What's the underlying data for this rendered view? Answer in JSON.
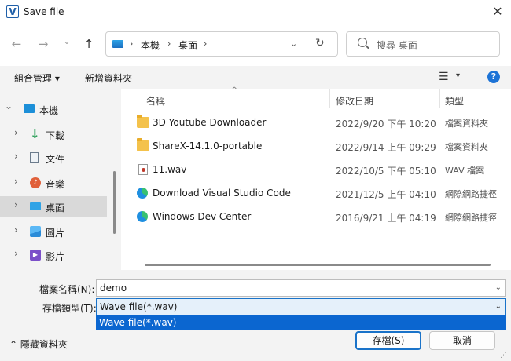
{
  "window": {
    "app_icon_letter": "V",
    "title": "Save file",
    "close_glyph": "✕"
  },
  "nav": {
    "back_glyph": "←",
    "forward_glyph": "→",
    "history_glyph": "⌄",
    "up_glyph": "↑",
    "breadcrumb": [
      "本機",
      "桌面"
    ],
    "refresh_glyph": "↻",
    "search_placeholder": "搜尋 桌面"
  },
  "toolbar": {
    "organize_label": "組合管理 ▾",
    "new_folder_label": "新增資料夾",
    "view_glyph": "☰",
    "view_chevron": "▾",
    "help_glyph": "?"
  },
  "sidebar": {
    "items": [
      {
        "label": "本機",
        "icon": "pc-icon",
        "chevron": "⌄",
        "color": "#1c8fd8"
      },
      {
        "label": "下載",
        "icon": "download-icon",
        "chevron": "›",
        "color": "#2e9f5a"
      },
      {
        "label": "文件",
        "icon": "documents-icon",
        "chevron": "›",
        "color": "#6b7b8c"
      },
      {
        "label": "音樂",
        "icon": "music-icon",
        "chevron": "›",
        "color": "#e0603a"
      },
      {
        "label": "桌面",
        "icon": "desktop-icon",
        "chevron": "›",
        "color": "#2fa3e6"
      },
      {
        "label": "圖片",
        "icon": "pictures-icon",
        "chevron": "›",
        "color": "#2a8bd8"
      },
      {
        "label": "影片",
        "icon": "videos-icon",
        "chevron": "›",
        "color": "#7b4fc9"
      }
    ]
  },
  "filelist": {
    "columns": [
      "名稱",
      "修改日期",
      "類型"
    ],
    "sort_glyph": "^",
    "rows": [
      {
        "name": "3D Youtube Downloader",
        "date": "2022/9/20 下午 10:20",
        "type": "檔案資料夾",
        "icon": "folder-icon"
      },
      {
        "name": "ShareX-14.1.0-portable",
        "date": "2022/9/14 上午 09:29",
        "type": "檔案資料夾",
        "icon": "folder-icon"
      },
      {
        "name": "11.wav",
        "date": "2022/10/5 下午 05:10",
        "type": "WAV 檔案",
        "icon": "wav-file-icon"
      },
      {
        "name": "Download Visual Studio Code",
        "date": "2021/12/5 上午 04:10",
        "type": "網際網路捷徑",
        "icon": "edge-shortcut-icon"
      },
      {
        "name": "Windows Dev Center",
        "date": "2016/9/21 上午 04:19",
        "type": "網際網路捷徑",
        "icon": "edge-shortcut-icon"
      }
    ]
  },
  "form": {
    "filename_label": "檔案名稱(N):",
    "filename_value": "demo",
    "filetype_label": "存檔類型(T):",
    "filetype_value": "Wave file(*.wav)",
    "filetype_option": "Wave file(*.wav)",
    "chevron": "⌄"
  },
  "footer": {
    "hide_folders_label": "⌃  隱藏資料夾",
    "save_label": "存檔(S)",
    "cancel_label": "取消"
  },
  "colors": {
    "accent": "#1a73c9",
    "selection": "#0b66d0",
    "panel": "#f3f3f3"
  }
}
